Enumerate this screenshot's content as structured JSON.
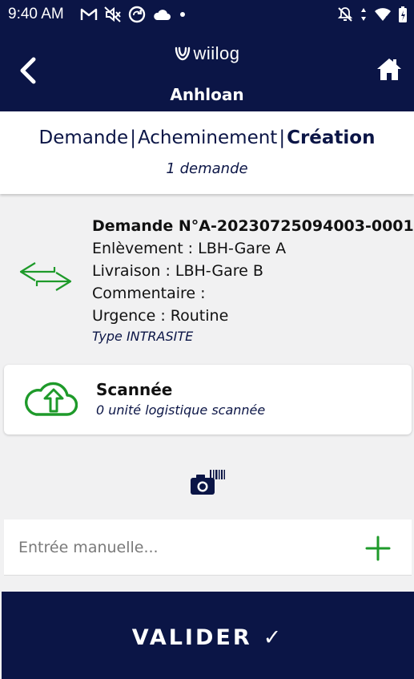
{
  "status_bar": {
    "time": "9:40 AM",
    "left_icons": [
      "gmail-icon",
      "mute-icon",
      "sync-icon",
      "cloud-icon",
      "dot-icon"
    ],
    "right_icons": [
      "notifications-off-icon",
      "data-arrows-icon",
      "wifi-icon",
      "battery-charging-icon"
    ]
  },
  "app_bar": {
    "logo_text": "wiilog",
    "title": "Anhloan",
    "back_icon": "chevron-left-icon",
    "home_icon": "home-icon"
  },
  "stepper": {
    "steps": [
      "Demande",
      "Acheminement",
      "Création"
    ],
    "separator": "|",
    "active_step": "Création",
    "subtitle": "1 demande"
  },
  "demande": {
    "title": "Demande N°A-20230725094003-0001",
    "enlevement": "Enlèvement : LBH-Gare A",
    "livraison": "Livraison : LBH-Gare B",
    "commentaire": "Commentaire :",
    "urgence": "Urgence : Routine",
    "type": "Type INTRASITE",
    "icon": "transfer-arrows-icon"
  },
  "scan_card": {
    "title": "Scannée",
    "subtitle": "0 unité logistique scannée",
    "icon": "cloud-upload-icon"
  },
  "camera": {
    "icon": "camera-barcode-icon"
  },
  "manual_entry": {
    "value": "",
    "placeholder": "Entrée manuelle...",
    "add_icon": "plus-icon"
  },
  "validate_button": {
    "label": "VALIDER",
    "check": "✓"
  },
  "colors": {
    "navy": "#0b1546",
    "green": "#1e9a2a",
    "background": "#f1f1f2"
  }
}
